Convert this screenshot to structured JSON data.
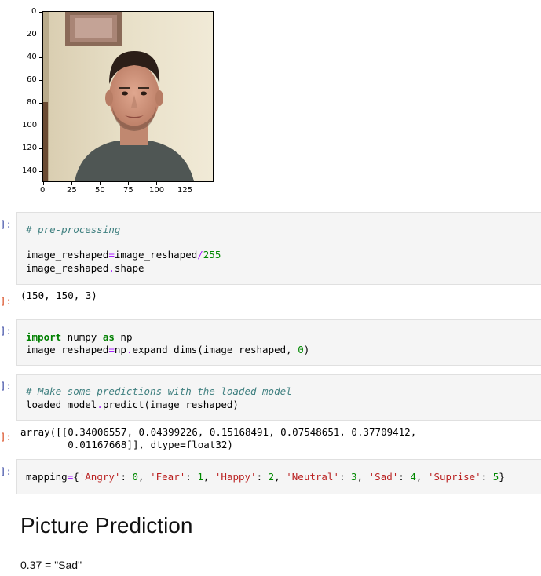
{
  "plot": {
    "y_ticks": [
      "0",
      "20",
      "40",
      "60",
      "80",
      "100",
      "120",
      "140"
    ],
    "x_ticks": [
      "0",
      "25",
      "50",
      "75",
      "100",
      "125"
    ],
    "image": "face-photo"
  },
  "cells": [
    {
      "prompt": "]:",
      "lines": [
        "# pre-processing",
        "",
        "image_reshaped=image_reshaped/255",
        "image_reshaped.shape"
      ]
    },
    {
      "prompt": "]:",
      "output": "(150, 150, 3)"
    },
    {
      "prompt": "]:",
      "lines": [
        "import numpy as np",
        "image_reshaped=np.expand_dims(image_reshaped, 0)"
      ]
    },
    {
      "prompt": "]:",
      "lines": [
        "# Make some predictions with the loaded model",
        "loaded_model.predict(image_reshaped)"
      ]
    },
    {
      "prompt": "]:",
      "output_lines": [
        "array([[0.34006557, 0.04399226, 0.15168491, 0.07548651, 0.37709412,",
        "        0.01167668]], dtype=float32)"
      ]
    },
    {
      "prompt": "]:",
      "lines": [
        "mapping={'Angry': 0, 'Fear': 1, 'Happy': 2, 'Neutral': 3, 'Sad': 4, 'Suprise': 5}"
      ]
    }
  ],
  "markdown": {
    "heading": "Picture Prediction",
    "text": "0.37 = \"Sad\""
  }
}
